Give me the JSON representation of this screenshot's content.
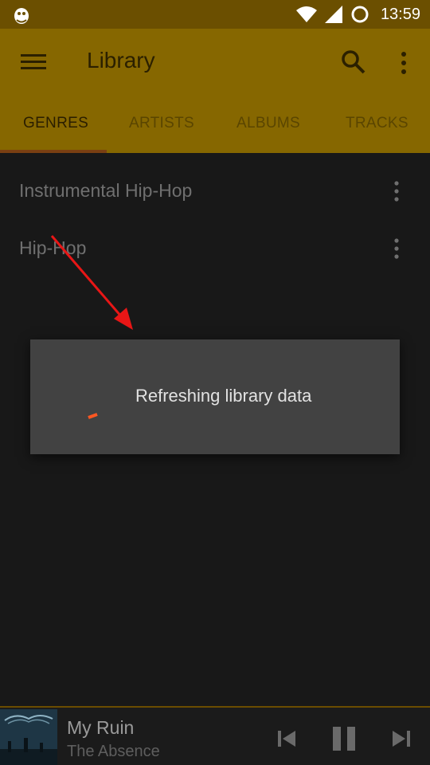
{
  "status_bar": {
    "time": "13:59",
    "icons": [
      "app-notification-icon",
      "wifi-icon",
      "cell-signal-icon",
      "sync-circle-icon"
    ]
  },
  "app_bar": {
    "title": "Library",
    "icons": [
      "hamburger-menu-icon",
      "search-icon",
      "overflow-menu-icon"
    ]
  },
  "tabs": [
    {
      "label": "GENRES",
      "active": true
    },
    {
      "label": "ARTISTS",
      "active": false
    },
    {
      "label": "ALBUMS",
      "active": false
    },
    {
      "label": "TRACKS",
      "active": false
    }
  ],
  "genres": [
    {
      "label": "Instrumental Hip-Hop"
    },
    {
      "label": "Hip-Hop"
    }
  ],
  "dialog": {
    "message": "Refreshing library data"
  },
  "now_playing": {
    "title": "My Ruin",
    "artist": "The Absence"
  },
  "colors": {
    "accent": "#ff5722",
    "primary": "#866700",
    "status_bar": "#6b4f00",
    "background": "#181818",
    "dialog": "#424242"
  }
}
